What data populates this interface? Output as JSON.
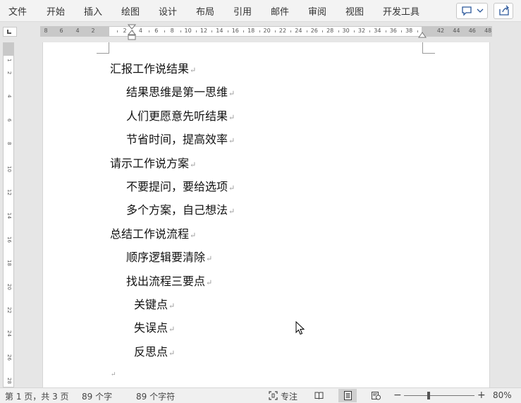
{
  "menu": {
    "items": [
      "文件",
      "开始",
      "插入",
      "绘图",
      "设计",
      "布局",
      "引用",
      "邮件",
      "审阅",
      "视图",
      "开发工具"
    ]
  },
  "ruler": {
    "left_numbers": [
      "8",
      "6",
      "4",
      "2"
    ],
    "numbers": [
      "2",
      "4",
      "6",
      "8",
      "10",
      "12",
      "14",
      "16",
      "18",
      "20",
      "22",
      "24",
      "26",
      "28",
      "30",
      "32",
      "34",
      "36",
      "38"
    ],
    "right_numbers": [
      "42",
      "44",
      "46",
      "48"
    ],
    "vertical_numbers": [
      "1",
      "2",
      "4",
      "6",
      "8",
      "10",
      "12",
      "14",
      "16",
      "18",
      "20",
      "22",
      "24",
      "26",
      "28"
    ]
  },
  "document": {
    "lines": [
      {
        "text": "汇报工作说结果",
        "level": 0
      },
      {
        "text": "结果思维是第一思维",
        "level": 1
      },
      {
        "text": "人们更愿意先听结果",
        "level": 1
      },
      {
        "text": "节省时间，提高效率",
        "level": 1
      },
      {
        "text": "请示工作说方案",
        "level": 0
      },
      {
        "text": "不要提问，要给选项",
        "level": 1
      },
      {
        "text": "多个方案，自己想法",
        "level": 1
      },
      {
        "text": "总结工作说流程",
        "level": 0
      },
      {
        "text": "顺序逻辑要清除",
        "level": 1
      },
      {
        "text": "找出流程三要点",
        "level": 1
      },
      {
        "text": "关键点",
        "level": 2
      },
      {
        "text": "失误点",
        "level": 2
      },
      {
        "text": "反思点",
        "level": 2
      },
      {
        "text": "",
        "level": 0
      }
    ],
    "paragraph_mark": "↵"
  },
  "status": {
    "page": "第 1 页，共 3 页",
    "words": "89 个字",
    "chars": "89 个字符",
    "focus": "专注",
    "zoom_minus": "−",
    "zoom_plus": "+",
    "zoom": "80%",
    "zoom_fraction": 0.35
  },
  "colors": {
    "ribbon_bg": "#f3f3f3",
    "accent": "#2b579a",
    "paragraph_mark": "#999999"
  }
}
